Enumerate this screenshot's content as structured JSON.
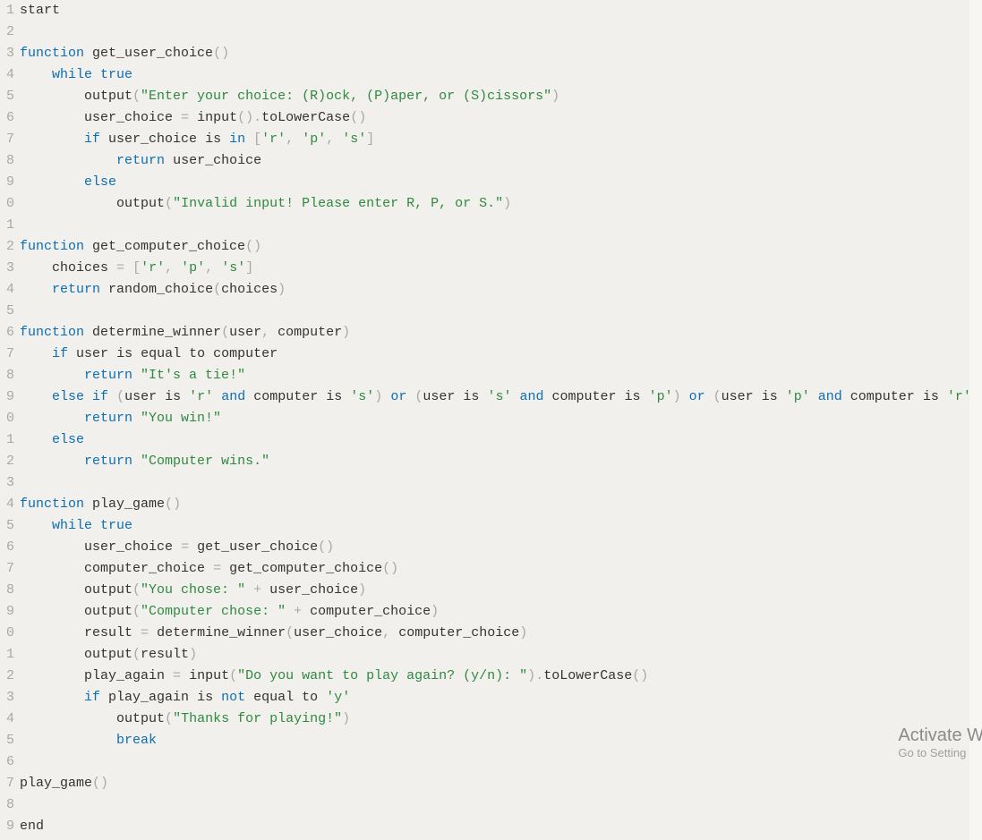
{
  "watermark": {
    "title": "Activate W",
    "sub": "Go to Setting"
  },
  "colors": {
    "keyword": "#0a6fb3",
    "string": "#2d8a3e",
    "punct": "#a8a8a8",
    "text": "#333333",
    "bg": "#f2f0ec"
  },
  "lines": [
    {
      "n": 1,
      "t": [
        [
          "ident",
          "start"
        ]
      ]
    },
    {
      "n": 2,
      "t": []
    },
    {
      "n": 3,
      "t": [
        [
          "kw",
          "function"
        ],
        [
          "sp",
          " "
        ],
        [
          "ident",
          "get_user_choice"
        ],
        [
          "punc",
          "("
        ],
        [
          "punc",
          ")"
        ]
      ]
    },
    {
      "n": 4,
      "t": [
        [
          "sp",
          "    "
        ],
        [
          "kw",
          "while"
        ],
        [
          "sp",
          " "
        ],
        [
          "kw",
          "true"
        ]
      ]
    },
    {
      "n": 5,
      "t": [
        [
          "sp",
          "        "
        ],
        [
          "ident",
          "output"
        ],
        [
          "punc",
          "("
        ],
        [
          "str",
          "\"Enter your choice: (R)ock, (P)aper, or (S)cissors\""
        ],
        [
          "punc",
          ")"
        ]
      ]
    },
    {
      "n": 6,
      "t": [
        [
          "sp",
          "        "
        ],
        [
          "ident",
          "user_choice"
        ],
        [
          "sp",
          " "
        ],
        [
          "punc",
          "="
        ],
        [
          "sp",
          " "
        ],
        [
          "ident",
          "input"
        ],
        [
          "punc",
          "("
        ],
        [
          "punc",
          ")"
        ],
        [
          "punc",
          "."
        ],
        [
          "ident",
          "toLowerCase"
        ],
        [
          "punc",
          "("
        ],
        [
          "punc",
          ")"
        ]
      ]
    },
    {
      "n": 7,
      "t": [
        [
          "sp",
          "        "
        ],
        [
          "kw",
          "if"
        ],
        [
          "sp",
          " "
        ],
        [
          "ident",
          "user_choice"
        ],
        [
          "sp",
          " "
        ],
        [
          "ident",
          "is"
        ],
        [
          "sp",
          " "
        ],
        [
          "kw",
          "in"
        ],
        [
          "sp",
          " "
        ],
        [
          "punc",
          "["
        ],
        [
          "str",
          "'r'"
        ],
        [
          "punc",
          ","
        ],
        [
          "sp",
          " "
        ],
        [
          "str",
          "'p'"
        ],
        [
          "punc",
          ","
        ],
        [
          "sp",
          " "
        ],
        [
          "str",
          "'s'"
        ],
        [
          "punc",
          "]"
        ]
      ]
    },
    {
      "n": 8,
      "t": [
        [
          "sp",
          "            "
        ],
        [
          "kw",
          "return"
        ],
        [
          "sp",
          " "
        ],
        [
          "ident",
          "user_choice"
        ]
      ]
    },
    {
      "n": 9,
      "t": [
        [
          "sp",
          "        "
        ],
        [
          "kw",
          "else"
        ]
      ]
    },
    {
      "n": 0,
      "t": [
        [
          "sp",
          "            "
        ],
        [
          "ident",
          "output"
        ],
        [
          "punc",
          "("
        ],
        [
          "str",
          "\"Invalid input! Please enter R, P, or S.\""
        ],
        [
          "punc",
          ")"
        ]
      ]
    },
    {
      "n": 1,
      "t": []
    },
    {
      "n": 2,
      "t": [
        [
          "kw",
          "function"
        ],
        [
          "sp",
          " "
        ],
        [
          "ident",
          "get_computer_choice"
        ],
        [
          "punc",
          "("
        ],
        [
          "punc",
          ")"
        ]
      ]
    },
    {
      "n": 3,
      "t": [
        [
          "sp",
          "    "
        ],
        [
          "ident",
          "choices"
        ],
        [
          "sp",
          " "
        ],
        [
          "punc",
          "="
        ],
        [
          "sp",
          " "
        ],
        [
          "punc",
          "["
        ],
        [
          "str",
          "'r'"
        ],
        [
          "punc",
          ","
        ],
        [
          "sp",
          " "
        ],
        [
          "str",
          "'p'"
        ],
        [
          "punc",
          ","
        ],
        [
          "sp",
          " "
        ],
        [
          "str",
          "'s'"
        ],
        [
          "punc",
          "]"
        ]
      ]
    },
    {
      "n": 4,
      "t": [
        [
          "sp",
          "    "
        ],
        [
          "kw",
          "return"
        ],
        [
          "sp",
          " "
        ],
        [
          "ident",
          "random_choice"
        ],
        [
          "punc",
          "("
        ],
        [
          "ident",
          "choices"
        ],
        [
          "punc",
          ")"
        ]
      ]
    },
    {
      "n": 5,
      "t": []
    },
    {
      "n": 6,
      "t": [
        [
          "kw",
          "function"
        ],
        [
          "sp",
          " "
        ],
        [
          "ident",
          "determine_winner"
        ],
        [
          "punc",
          "("
        ],
        [
          "ident",
          "user"
        ],
        [
          "punc",
          ","
        ],
        [
          "sp",
          " "
        ],
        [
          "ident",
          "computer"
        ],
        [
          "punc",
          ")"
        ]
      ]
    },
    {
      "n": 7,
      "t": [
        [
          "sp",
          "    "
        ],
        [
          "kw",
          "if"
        ],
        [
          "sp",
          " "
        ],
        [
          "ident",
          "user"
        ],
        [
          "sp",
          " "
        ],
        [
          "ident",
          "is"
        ],
        [
          "sp",
          " "
        ],
        [
          "ident",
          "equal"
        ],
        [
          "sp",
          " "
        ],
        [
          "ident",
          "to"
        ],
        [
          "sp",
          " "
        ],
        [
          "ident",
          "computer"
        ]
      ]
    },
    {
      "n": 8,
      "t": [
        [
          "sp",
          "        "
        ],
        [
          "kw",
          "return"
        ],
        [
          "sp",
          " "
        ],
        [
          "str",
          "\"It's a tie!\""
        ]
      ]
    },
    {
      "n": 9,
      "t": [
        [
          "sp",
          "    "
        ],
        [
          "kw",
          "else"
        ],
        [
          "sp",
          " "
        ],
        [
          "kw",
          "if"
        ],
        [
          "sp",
          " "
        ],
        [
          "punc",
          "("
        ],
        [
          "ident",
          "user"
        ],
        [
          "sp",
          " "
        ],
        [
          "ident",
          "is"
        ],
        [
          "sp",
          " "
        ],
        [
          "str",
          "'r'"
        ],
        [
          "sp",
          " "
        ],
        [
          "kw",
          "and"
        ],
        [
          "sp",
          " "
        ],
        [
          "ident",
          "computer"
        ],
        [
          "sp",
          " "
        ],
        [
          "ident",
          "is"
        ],
        [
          "sp",
          " "
        ],
        [
          "str",
          "'s'"
        ],
        [
          "punc",
          ")"
        ],
        [
          "sp",
          " "
        ],
        [
          "kw",
          "or"
        ],
        [
          "sp",
          " "
        ],
        [
          "punc",
          "("
        ],
        [
          "ident",
          "user"
        ],
        [
          "sp",
          " "
        ],
        [
          "ident",
          "is"
        ],
        [
          "sp",
          " "
        ],
        [
          "str",
          "'s'"
        ],
        [
          "sp",
          " "
        ],
        [
          "kw",
          "and"
        ],
        [
          "sp",
          " "
        ],
        [
          "ident",
          "computer"
        ],
        [
          "sp",
          " "
        ],
        [
          "ident",
          "is"
        ],
        [
          "sp",
          " "
        ],
        [
          "str",
          "'p'"
        ],
        [
          "punc",
          ")"
        ],
        [
          "sp",
          " "
        ],
        [
          "kw",
          "or"
        ],
        [
          "sp",
          " "
        ],
        [
          "punc",
          "("
        ],
        [
          "ident",
          "user"
        ],
        [
          "sp",
          " "
        ],
        [
          "ident",
          "is"
        ],
        [
          "sp",
          " "
        ],
        [
          "str",
          "'p'"
        ],
        [
          "sp",
          " "
        ],
        [
          "kw",
          "and"
        ],
        [
          "sp",
          " "
        ],
        [
          "ident",
          "computer"
        ],
        [
          "sp",
          " "
        ],
        [
          "ident",
          "is"
        ],
        [
          "sp",
          " "
        ],
        [
          "str",
          "'r'"
        ],
        [
          "punc",
          ")"
        ]
      ]
    },
    {
      "n": 0,
      "t": [
        [
          "sp",
          "        "
        ],
        [
          "kw",
          "return"
        ],
        [
          "sp",
          " "
        ],
        [
          "str",
          "\"You win!\""
        ]
      ]
    },
    {
      "n": 1,
      "t": [
        [
          "sp",
          "    "
        ],
        [
          "kw",
          "else"
        ]
      ]
    },
    {
      "n": 2,
      "t": [
        [
          "sp",
          "        "
        ],
        [
          "kw",
          "return"
        ],
        [
          "sp",
          " "
        ],
        [
          "str",
          "\"Computer wins.\""
        ]
      ]
    },
    {
      "n": 3,
      "t": []
    },
    {
      "n": 4,
      "t": [
        [
          "kw",
          "function"
        ],
        [
          "sp",
          " "
        ],
        [
          "ident",
          "play_game"
        ],
        [
          "punc",
          "("
        ],
        [
          "punc",
          ")"
        ]
      ]
    },
    {
      "n": 5,
      "t": [
        [
          "sp",
          "    "
        ],
        [
          "kw",
          "while"
        ],
        [
          "sp",
          " "
        ],
        [
          "kw",
          "true"
        ]
      ]
    },
    {
      "n": 6,
      "t": [
        [
          "sp",
          "        "
        ],
        [
          "ident",
          "user_choice"
        ],
        [
          "sp",
          " "
        ],
        [
          "punc",
          "="
        ],
        [
          "sp",
          " "
        ],
        [
          "ident",
          "get_user_choice"
        ],
        [
          "punc",
          "("
        ],
        [
          "punc",
          ")"
        ]
      ]
    },
    {
      "n": 7,
      "t": [
        [
          "sp",
          "        "
        ],
        [
          "ident",
          "computer_choice"
        ],
        [
          "sp",
          " "
        ],
        [
          "punc",
          "="
        ],
        [
          "sp",
          " "
        ],
        [
          "ident",
          "get_computer_choice"
        ],
        [
          "punc",
          "("
        ],
        [
          "punc",
          ")"
        ]
      ]
    },
    {
      "n": 8,
      "t": [
        [
          "sp",
          "        "
        ],
        [
          "ident",
          "output"
        ],
        [
          "punc",
          "("
        ],
        [
          "str",
          "\"You chose: \""
        ],
        [
          "sp",
          " "
        ],
        [
          "punc",
          "+"
        ],
        [
          "sp",
          " "
        ],
        [
          "ident",
          "user_choice"
        ],
        [
          "punc",
          ")"
        ]
      ]
    },
    {
      "n": 9,
      "t": [
        [
          "sp",
          "        "
        ],
        [
          "ident",
          "output"
        ],
        [
          "punc",
          "("
        ],
        [
          "str",
          "\"Computer chose: \""
        ],
        [
          "sp",
          " "
        ],
        [
          "punc",
          "+"
        ],
        [
          "sp",
          " "
        ],
        [
          "ident",
          "computer_choice"
        ],
        [
          "punc",
          ")"
        ]
      ]
    },
    {
      "n": 0,
      "t": [
        [
          "sp",
          "        "
        ],
        [
          "ident",
          "result"
        ],
        [
          "sp",
          " "
        ],
        [
          "punc",
          "="
        ],
        [
          "sp",
          " "
        ],
        [
          "ident",
          "determine_winner"
        ],
        [
          "punc",
          "("
        ],
        [
          "ident",
          "user_choice"
        ],
        [
          "punc",
          ","
        ],
        [
          "sp",
          " "
        ],
        [
          "ident",
          "computer_choice"
        ],
        [
          "punc",
          ")"
        ]
      ]
    },
    {
      "n": 1,
      "t": [
        [
          "sp",
          "        "
        ],
        [
          "ident",
          "output"
        ],
        [
          "punc",
          "("
        ],
        [
          "ident",
          "result"
        ],
        [
          "punc",
          ")"
        ]
      ]
    },
    {
      "n": 2,
      "t": [
        [
          "sp",
          "        "
        ],
        [
          "ident",
          "play_again"
        ],
        [
          "sp",
          " "
        ],
        [
          "punc",
          "="
        ],
        [
          "sp",
          " "
        ],
        [
          "ident",
          "input"
        ],
        [
          "punc",
          "("
        ],
        [
          "str",
          "\"Do you want to play again? (y/n): \""
        ],
        [
          "punc",
          ")"
        ],
        [
          "punc",
          "."
        ],
        [
          "ident",
          "toLowerCase"
        ],
        [
          "punc",
          "("
        ],
        [
          "punc",
          ")"
        ]
      ]
    },
    {
      "n": 3,
      "t": [
        [
          "sp",
          "        "
        ],
        [
          "kw",
          "if"
        ],
        [
          "sp",
          " "
        ],
        [
          "ident",
          "play_again"
        ],
        [
          "sp",
          " "
        ],
        [
          "ident",
          "is"
        ],
        [
          "sp",
          " "
        ],
        [
          "kw",
          "not"
        ],
        [
          "sp",
          " "
        ],
        [
          "ident",
          "equal"
        ],
        [
          "sp",
          " "
        ],
        [
          "ident",
          "to"
        ],
        [
          "sp",
          " "
        ],
        [
          "str",
          "'y'"
        ]
      ]
    },
    {
      "n": 4,
      "t": [
        [
          "sp",
          "            "
        ],
        [
          "ident",
          "output"
        ],
        [
          "punc",
          "("
        ],
        [
          "str",
          "\"Thanks for playing!\""
        ],
        [
          "punc",
          ")"
        ]
      ]
    },
    {
      "n": 5,
      "t": [
        [
          "sp",
          "            "
        ],
        [
          "kw",
          "break"
        ]
      ]
    },
    {
      "n": 6,
      "t": []
    },
    {
      "n": 7,
      "t": [
        [
          "ident",
          "play_game"
        ],
        [
          "punc",
          "("
        ],
        [
          "punc",
          ")"
        ]
      ]
    },
    {
      "n": 8,
      "t": []
    },
    {
      "n": 9,
      "t": [
        [
          "ident",
          "end"
        ]
      ]
    }
  ]
}
